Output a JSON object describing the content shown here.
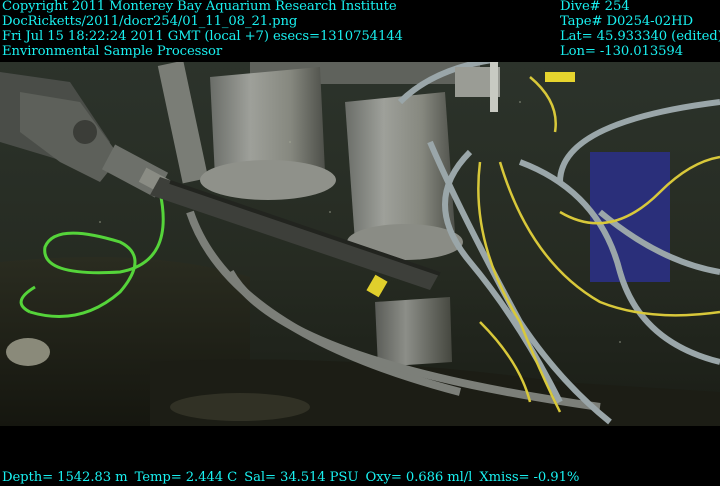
{
  "header_left": [
    "Copyright 2011 Monterey Bay Aquarium Research Institute",
    "DocRicketts/2011/docr254/01_11_08_21.png",
    "Fri Jul 15 18:22:24 2011 GMT (local +7)  esecs=1310754144",
    "Environmental Sample Processor"
  ],
  "header_right": [
    "Dive# 254",
    "Tape# D0254-02HD",
    "Lat= 45.933340 (edited)",
    "Lon= -130.013594"
  ],
  "footer": {
    "depth": "Depth= 1542.83 m",
    "temp": "Temp= 2.444 C",
    "sal": "Sal= 34.514 PSU",
    "oxy": "Oxy= 0.686 ml/l",
    "xmiss": "Xmiss= -0.91%"
  },
  "colors": {
    "overlay_text": "#19f0f0",
    "background": "#000000"
  }
}
